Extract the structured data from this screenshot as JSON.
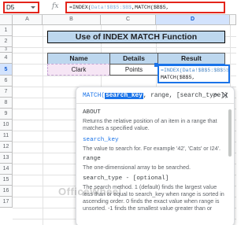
{
  "formula_bar": {
    "cell_ref": "D5",
    "fx_label": "fx",
    "formula_prefix": "=INDEX(",
    "formula_ref": "Data!$B$5:$B$",
    "formula_suffix": ",MATCH($B$5,"
  },
  "columns": [
    "A",
    "B",
    "C",
    "D"
  ],
  "rows": [
    "1",
    "2",
    "3",
    "4",
    "5",
    "6",
    "7",
    "8",
    "9",
    "10",
    "11",
    "12",
    "13",
    "14",
    "15",
    "16",
    "17"
  ],
  "active_cell": {
    "row": "5",
    "column": "D"
  },
  "sheet": {
    "title": "Use of INDEX MATCH Function",
    "headers": [
      "Name",
      "Details",
      "Result"
    ],
    "row5": {
      "name": "Clark",
      "details": "Points"
    },
    "incell_line1": "=INDEX(Data!$B$5:$B$",
    "incell_line1_dim": "5$",
    "incell_line2": "MATCH($B$5,"
  },
  "help_popup": {
    "func_name": "MATCH(",
    "active_arg": "search_key",
    "rest_args": ", range, [search_type])",
    "about_title": "ABOUT",
    "about_text": "Returns the relative position of an item in a range that matches a specified value.",
    "search_key_title": "search_key",
    "search_key_text": "The value to search for. For example '42', 'Cats' or I24'.",
    "range_title": "range",
    "range_text": "The one-dimensional array to be searched.",
    "search_type_title": "search_type - [optional]",
    "search_type_text": "The search method. 1 (default) finds the largest value less than or equal to search_key when range is sorted in ascending order. 0 finds the exact value when range is unsorted. -1 finds the smallest value greater than or"
  },
  "watermark": "OfficeWheel"
}
